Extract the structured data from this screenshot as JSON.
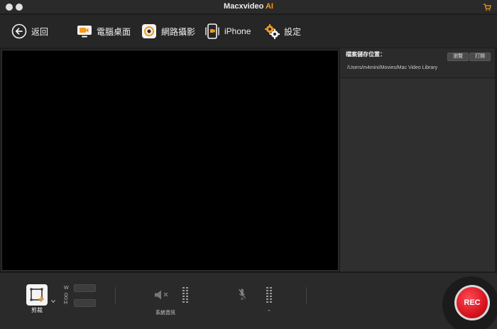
{
  "window": {
    "title_main": "Macxvideo ",
    "title_accent": "AI",
    "accent_color": "#f39a1e"
  },
  "toolbar": {
    "back_label": "返回",
    "desktop_label": "電腦桌面",
    "webcam_label": "網路攝影",
    "iphone_label": "iPhone",
    "settings_label": "設定"
  },
  "side_panel": {
    "save_location_label": "檔案儲存位置：",
    "browse_label": "瀏覽",
    "open_label": "打開",
    "path": "/Users/m4mini/Movies/Mac Video Library"
  },
  "bottom": {
    "crop_label": "剪裁",
    "width_label": "W",
    "height_label": "H",
    "system_audio_label": "系統音訊",
    "updown_glyph": "⌃",
    "rec_label": "REC",
    "rec_color": "#d6141f"
  }
}
